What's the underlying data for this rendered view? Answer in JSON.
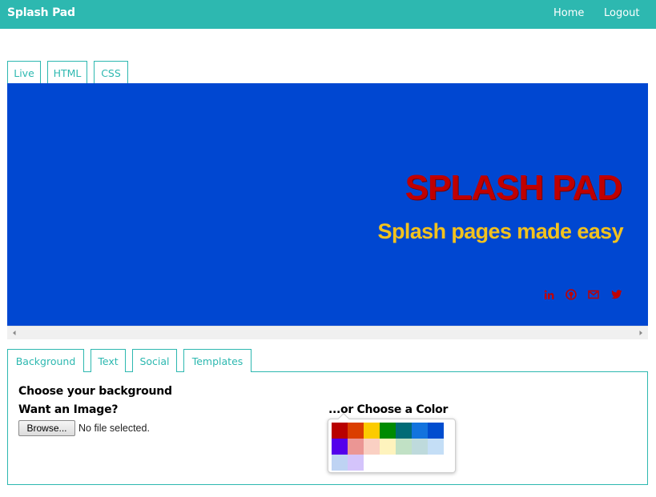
{
  "navbar": {
    "brand": "Splash Pad",
    "home_label": "Home",
    "logout_label": "Logout"
  },
  "preview_tabs": [
    "Live",
    "HTML",
    "CSS"
  ],
  "preview": {
    "background_color": "#0047d1",
    "title": "SPLASH PAD",
    "subtitle": "Splash pages made easy",
    "title_color": "#c00000",
    "subtitle_color": "#f2c21e",
    "social_icons": [
      "linkedin-icon",
      "github-icon",
      "mail-icon",
      "twitter-icon"
    ]
  },
  "editor_tabs": [
    "Background",
    "Text",
    "Social",
    "Templates"
  ],
  "background_panel": {
    "heading": "Choose your background",
    "image_heading": "Want an Image?",
    "browse_label": "Browse...",
    "file_status": "No file selected.",
    "color_heading": "...or Choose a Color"
  },
  "color_swatches": [
    "#b80000",
    "#db3e00",
    "#fccb00",
    "#008b02",
    "#006b76",
    "#1273de",
    "#004dcf",
    "#5300eb",
    "#eb9694",
    "#fad0c3",
    "#fef3bd",
    "#c1e1c5",
    "#bedadc",
    "#c4def6",
    "#bed3f3",
    "#d4c4fb"
  ],
  "colors": {
    "accent": "#2db8b0"
  }
}
